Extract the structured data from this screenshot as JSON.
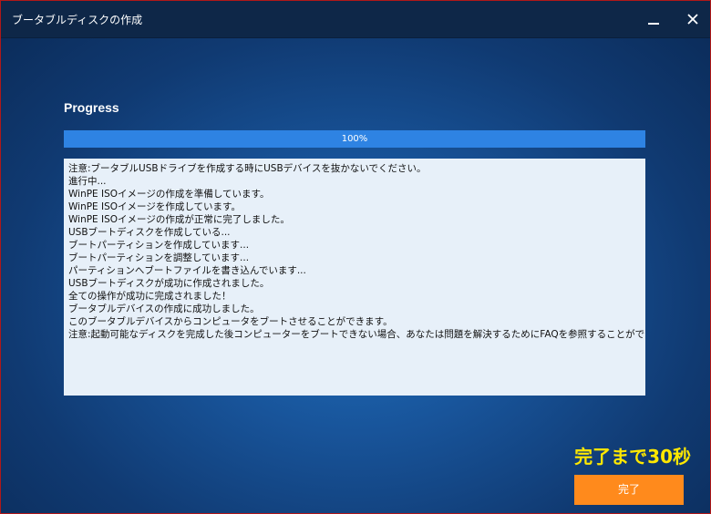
{
  "window": {
    "title": "ブータブルディスクの作成",
    "close_glyph": "✕"
  },
  "progress": {
    "label": "Progress",
    "value": 100,
    "percent_text": "100%"
  },
  "log": {
    "lines": [
      "注意:ブータブルUSBドライブを作成する時にUSBデバイスを抜かないでください。",
      "進行中...",
      "WinPE ISOイメージの作成を準備しています。",
      "WinPE ISOイメージを作成しています。",
      "WinPE ISOイメージの作成が正常に完了しました。",
      "USBブートディスクを作成している...",
      "ブートパーティションを作成しています...",
      "ブートパーティションを調整しています...",
      "パーティションへブートファイルを書き込んでいます...",
      "USBブートディスクが成功に作成されました。",
      "全ての操作が成功に完成されました！",
      "ブータブルデバイスの作成に成功しました。",
      "このブータブルデバイスからコンピュータをブートさせることができます。",
      "注意:起動可能なディスクを完成した後コンピューターをブートできない場合、あなたは問題を解決するためにFAQを参照することができます。"
    ]
  },
  "footer": {
    "countdown": "完了まで30秒",
    "finish_label": "完了"
  },
  "colors": {
    "accent": "#2e83e3",
    "button": "#ff8a1c",
    "countdown": "#ffe800"
  }
}
